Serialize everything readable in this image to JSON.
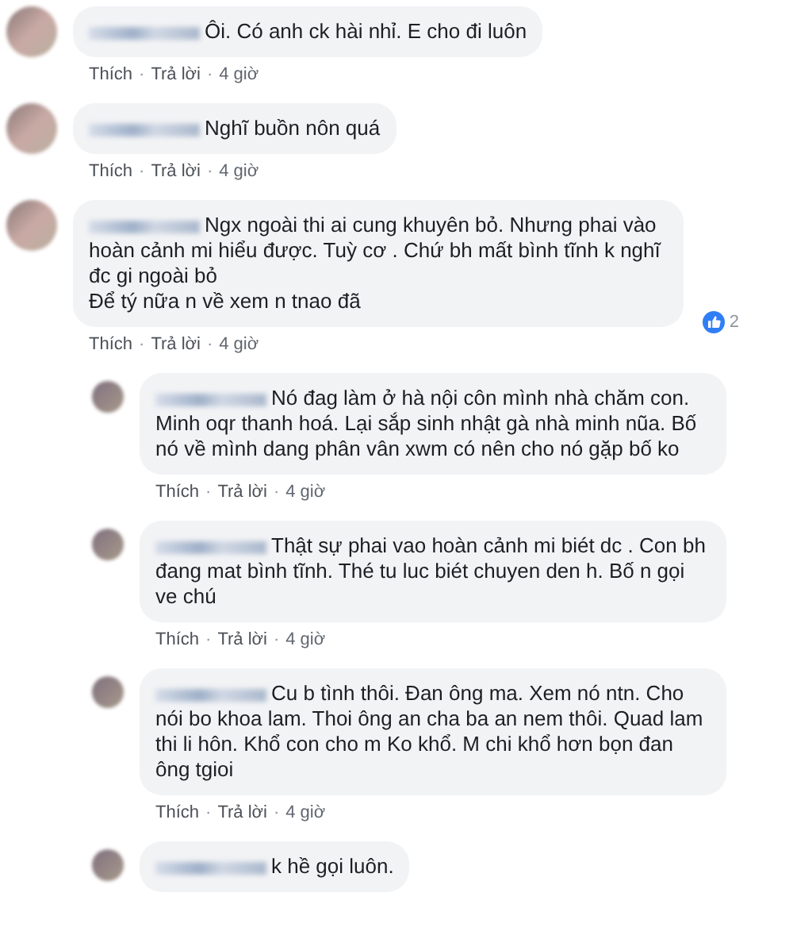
{
  "comments": [
    {
      "text": "Ôi. Có anh ck hài nhỉ. E cho đi luôn",
      "actions": {
        "like": "Thích",
        "sep1": "·",
        "reply": "Trả lời",
        "sep2": "·",
        "time": "4 giờ"
      }
    },
    {
      "text": "Nghĩ buồn nôn quá",
      "actions": {
        "like": "Thích",
        "sep1": "·",
        "reply": "Trả lời",
        "sep2": "·",
        "time": "4 giờ"
      }
    },
    {
      "text": "Ngx ngoài thi ai cung khuyên bỏ. Nhưng phai vào hoàn cảnh mi hiểu được. Tuỳ cơ . Chứ bh mất bình tĩnh k nghĩ đc gi ngoài bỏ\nĐể tý nữa n về xem n tnao đã",
      "reactions": {
        "count": "2"
      },
      "actions": {
        "like": "Thích",
        "sep1": "·",
        "reply": "Trả lời",
        "sep2": "·",
        "time": "4 giờ"
      },
      "children": [
        {
          "text": "Nó đag làm ở hà nội côn mình nhà chăm con. Minh oqr thanh hoá. Lại sắp sinh nhật gà nhà minh nũa. Bố nó về mình dang phân vân xwm có nên cho nó gặp bố ko",
          "actions": {
            "like": "Thích",
            "sep1": "·",
            "reply": "Trả lời",
            "sep2": "·",
            "time": "4 giờ"
          }
        },
        {
          "text": "Thật sự phai vao hoàn cảnh mi biét dc . Con bh đang mat bình tĩnh. Thé tu luc biét chuyen den h. Bố n gọi ve chú",
          "actions": {
            "like": "Thích",
            "sep1": "·",
            "reply": "Trả lời",
            "sep2": "·",
            "time": "4 giờ"
          }
        },
        {
          "text": "Cu b tình thôi. Đan ông ma. Xem nó ntn. Cho nói bo khoa lam. Thoi ông an cha ba an nem thôi. Quad lam thi li hôn. Khổ con cho m Ko khổ. M chi khổ hơn bọn đan ông tgioi",
          "actions": {
            "like": "Thích",
            "sep1": "·",
            "reply": "Trả lời",
            "sep2": "·",
            "time": "4 giờ"
          }
        },
        {
          "text": "k hề gọi luôn."
        }
      ]
    }
  ]
}
